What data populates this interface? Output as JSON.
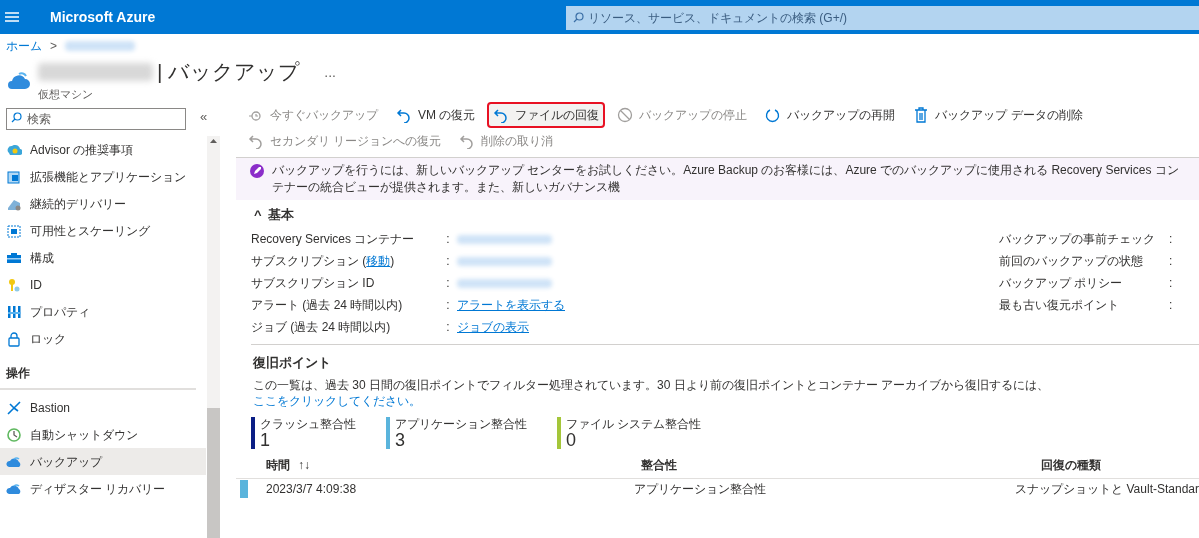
{
  "top_bar": {
    "brand": "Microsoft Azure",
    "search": {
      "placeholder": "リソース、サービス、ドキュメントの検索 (G+/)"
    }
  },
  "breadcrumb": [
    "ホーム",
    ">"
  ],
  "page": {
    "title": "| バックアップ",
    "more": "...",
    "subtitle": "仮想マシン"
  },
  "sidebar": {
    "search": {
      "placeholder": "検索"
    },
    "collapse": "«",
    "items": [
      {
        "kind": "item",
        "label": "Advisor の推奨事項",
        "selected": false
      },
      {
        "kind": "item",
        "label": "拡張機能とアプリケーション",
        "selected": false
      },
      {
        "kind": "item",
        "label": "継続的デリバリー",
        "selected": false
      },
      {
        "kind": "item",
        "label": "可用性とスケーリング",
        "selected": false
      },
      {
        "kind": "item",
        "label": "構成",
        "selected": false
      },
      {
        "kind": "item",
        "label": "ID",
        "selected": false
      },
      {
        "kind": "item",
        "label": "プロパティ",
        "selected": false
      },
      {
        "kind": "item",
        "label": "ロック",
        "selected": false
      },
      {
        "kind": "header",
        "label": "操作"
      },
      {
        "kind": "item",
        "label": "Bastion",
        "selected": false
      },
      {
        "kind": "item",
        "label": "自動シャットダウン",
        "selected": false
      },
      {
        "kind": "item",
        "label": "バックアップ",
        "selected": true
      },
      {
        "kind": "item",
        "label": "ディザスター リカバリー",
        "selected": false
      }
    ]
  },
  "toolbar": [
    {
      "label": "今すぐバックアップ",
      "disabled": true,
      "highlighted": false
    },
    {
      "label": "VM の復元",
      "disabled": false,
      "highlighted": false
    },
    {
      "label": "ファイルの回復",
      "disabled": false,
      "highlighted": true
    },
    {
      "label": "バックアップの停止",
      "disabled": true,
      "highlighted": false
    },
    {
      "label": "バックアップの再開",
      "disabled": false,
      "highlighted": false
    },
    {
      "label": "バックアップ データの削除",
      "disabled": false,
      "highlighted": false
    },
    {
      "label": "セカンダリ リージョンへの復元",
      "disabled": true,
      "highlighted": false
    },
    {
      "label": "削除の取り消",
      "disabled": true,
      "highlighted": false
    }
  ],
  "banner": "バックアップを行うには、新しいバックアップ センターをお試しください。Azure Backup のお客様には、Azure でのバックアップに使用される Recovery Services コンテナーの統合ビューが提供されます。また、新しいガバナンス機",
  "essentials": {
    "toggle": "^",
    "title": "基本",
    "left": [
      {
        "label": "Recovery Services コンテナー",
        "separator": ":",
        "kind": "blurred"
      },
      {
        "label": "サブスクリプション (",
        "link": "移動",
        "label_end": ")",
        "separator": ":",
        "kind": "blurred"
      },
      {
        "label": "サブスクリプション ID",
        "separator": ":",
        "kind": "blurred"
      },
      {
        "label": "アラート (過去 24 時間以内)",
        "separator": ":",
        "kind": "link",
        "value": "アラートを表示する"
      },
      {
        "label": "ジョブ (過去 24 時間以内)",
        "separator": ":",
        "kind": "link",
        "value": "ジョブの表示"
      }
    ],
    "right": [
      {
        "label": "バックアップの事前チェック",
        "separator": ":"
      },
      {
        "label": "前回のバックアップの状態",
        "separator": ":"
      },
      {
        "label": "バックアップ ポリシー",
        "separator": ":"
      },
      {
        "label": "最も古い復元ポイント",
        "separator": ":"
      }
    ]
  },
  "restore_points": {
    "title": "復旧ポイント",
    "description": "この一覧は、過去 30 日間の復旧ポイントでフィルター処理されています。30 日より前の復旧ポイントとコンテナー アーカイブから復旧するには、",
    "link": "ここをクリックしてください。",
    "counts": [
      {
        "label": "クラッシュ整合性",
        "value": "1",
        "color": "#0b1e85"
      },
      {
        "label": "アプリケーション整合性",
        "value": "3",
        "color": "#5ab4dc"
      },
      {
        "label": "ファイル システム整合性",
        "value": "0",
        "color": "#a4c63a"
      }
    ],
    "columns": [
      "時間",
      "整合性",
      "回復の種類"
    ],
    "sort": "↑↓",
    "rows": [
      [
        "2023/3/7 4:09:38",
        "アプリケーション整合性",
        "スナップショットと Vault-Standar"
      ]
    ]
  }
}
